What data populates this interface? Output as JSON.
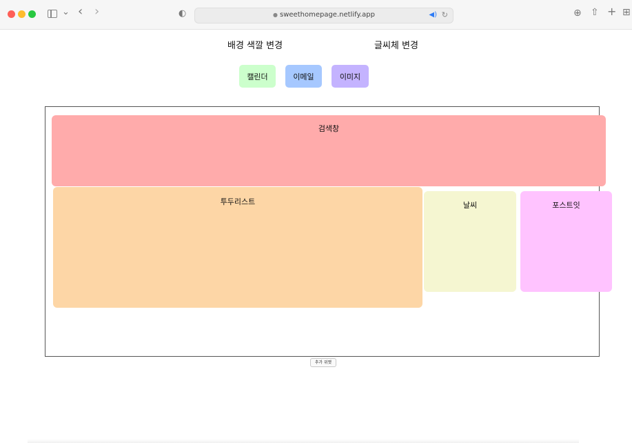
{
  "browser": {
    "url": "sweethomepage.netlify.app",
    "icons": {
      "close": "red-dot",
      "minimize": "yellow-dot",
      "zoom": "green-dot",
      "sidebar": "sidebar-icon",
      "back": "chevron-left-icon",
      "forward": "chevron-right-icon",
      "shield": "shield-icon",
      "lock": "lock-icon",
      "audio": "speaker-icon",
      "reload": "reload-icon",
      "download": "download-icon",
      "share": "share-icon",
      "new_tab": "plus-icon",
      "tab_overview": "grid-icon"
    },
    "glyphs": {
      "chevron_down": "⌄",
      "back": "‹",
      "forward": "›",
      "shield": "◐",
      "lock": "🔒",
      "audio": "◀)",
      "reload": "↻",
      "download": "⊕",
      "share": "⇧",
      "new_tab": "+",
      "tab_overview": "⊞"
    }
  },
  "header": {
    "background_change": "배경 색깔 변경",
    "font_change": "글씨체 변경"
  },
  "apps": [
    {
      "label": "캘린더",
      "color": "#ccffcc"
    },
    {
      "label": "이메일",
      "color": "#a6c8ff"
    },
    {
      "label": "이미지",
      "color": "#c4b3ff"
    }
  ],
  "widgets": {
    "search": {
      "label": "검색창",
      "color": "#ffabab"
    },
    "todo": {
      "label": "투두리스트",
      "color": "#fdd6a6"
    },
    "weather": {
      "label": "날씨",
      "color": "#f5f6d1"
    },
    "postit": {
      "label": "포스트잇",
      "color": "#ffc3ff"
    }
  },
  "footer": {
    "add_widget": "추가 위젯"
  }
}
